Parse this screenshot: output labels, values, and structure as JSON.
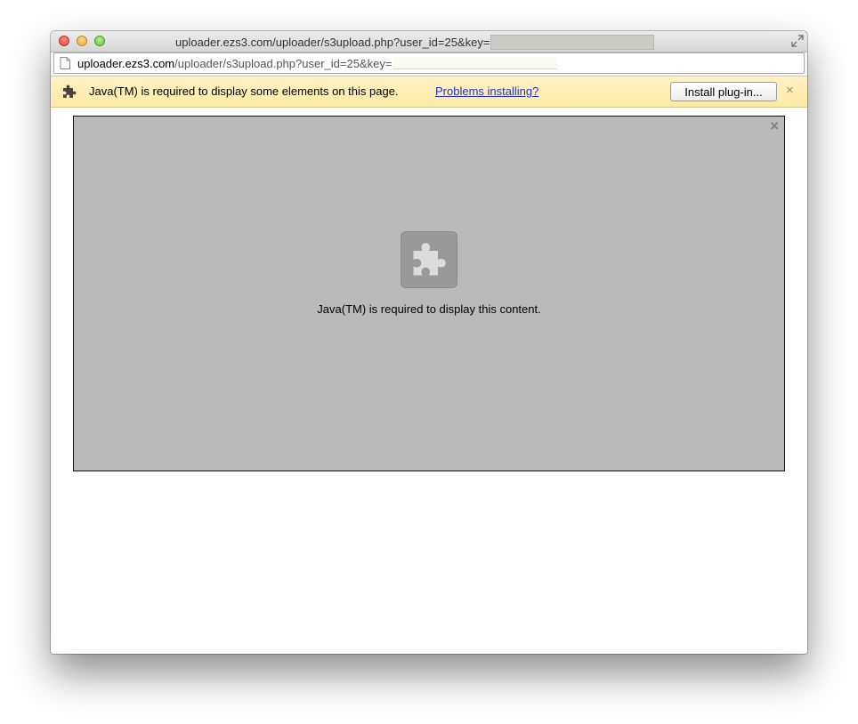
{
  "window": {
    "title_prefix": "uploader.ezs3.com/uploader/s3upload.php?user_id=25&key="
  },
  "addressbar": {
    "host": "uploader.ezs3.com",
    "path": "/uploader/s3upload.php?user_id=25&key="
  },
  "infobar": {
    "icon": "puzzle-piece-icon",
    "message": "Java(TM) is required to display some elements on this page.",
    "link": "Problems installing?",
    "button": "Install plug-in...",
    "close": "×"
  },
  "plugin": {
    "icon": "puzzle-piece-icon",
    "message": "Java(TM) is required to display this content.",
    "close": "×"
  },
  "colors": {
    "infobar_bg": "#fde9a6",
    "plugin_bg": "#bababa",
    "link": "#2233cc"
  }
}
